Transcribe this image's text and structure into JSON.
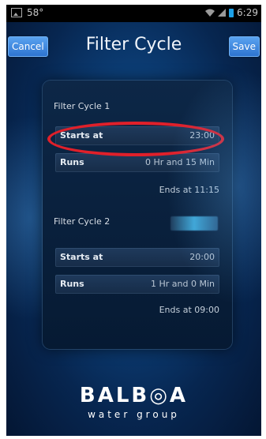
{
  "status_bar": {
    "left_indicator": "58°",
    "time": "6:29",
    "icons": [
      "image-icon",
      "wifi-icon",
      "signal-icon",
      "battery-icon"
    ]
  },
  "header": {
    "cancel_label": "Cancel",
    "title": "Filter Cycle",
    "save_label": "Save"
  },
  "filter_cycles": [
    {
      "label": "Filter Cycle 1",
      "starts_label": "Starts at",
      "starts_value": "23:00",
      "runs_label": "Runs",
      "runs_value": "0 Hr and 15 Min",
      "ends": "Ends at 11:15"
    },
    {
      "label": "Filter Cycle 2",
      "starts_label": "Starts at",
      "starts_value": "20:00",
      "runs_label": "Runs",
      "runs_value": "1 Hr and 0 Min",
      "ends": "Ends at 09:00"
    }
  ],
  "logo": {
    "brand": "BALB◎A",
    "tagline": "water group"
  },
  "colors": {
    "highlight": "#e0202a",
    "button": "#3a86e0",
    "background": "#0c3f78"
  }
}
